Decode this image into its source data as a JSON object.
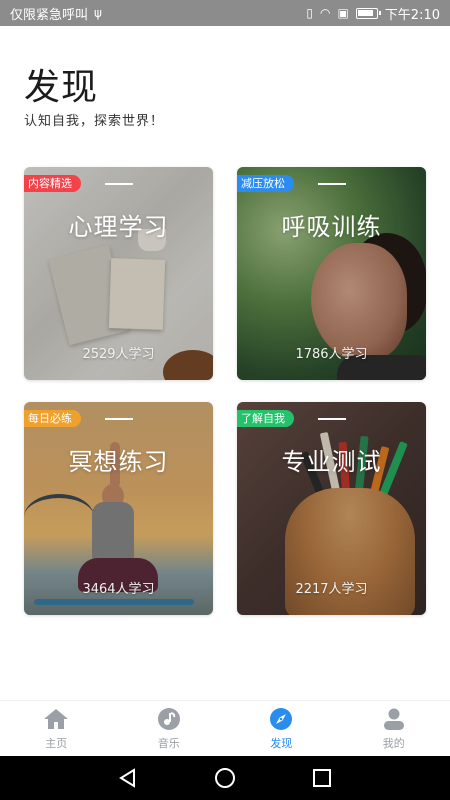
{
  "status_bar": {
    "carrier_text": "仅限紧急呼叫",
    "usb_icon": "usb-icon",
    "time": "下午2:10"
  },
  "page": {
    "title": "发现",
    "subtitle": "认知自我，探索世界！"
  },
  "cards": [
    {
      "tag": "内容精选",
      "tag_color": "#f2434a",
      "title": "心理学习",
      "count": "2529人学习"
    },
    {
      "tag": "减压放松",
      "tag_color": "#2b8cf0",
      "title": "呼吸训练",
      "count": "1786人学习"
    },
    {
      "tag": "每日必练",
      "tag_color": "#f0a12b",
      "title": "冥想练习",
      "count": "3464人学习"
    },
    {
      "tag": "了解自我",
      "tag_color": "#23c26b",
      "title": "专业测试",
      "count": "2217人学习"
    }
  ],
  "bottom_nav": {
    "items": [
      {
        "label": "主页",
        "icon": "home-icon"
      },
      {
        "label": "音乐",
        "icon": "music-icon"
      },
      {
        "label": "发现",
        "icon": "compass-icon",
        "active": true
      },
      {
        "label": "我的",
        "icon": "profile-icon"
      }
    ],
    "active_color": "#2b8cf0",
    "inactive_color": "#9aa0a6"
  },
  "system_nav": {
    "back_icon": "back-triangle-icon",
    "home_icon": "home-circle-icon",
    "recents_icon": "recents-square-icon"
  }
}
